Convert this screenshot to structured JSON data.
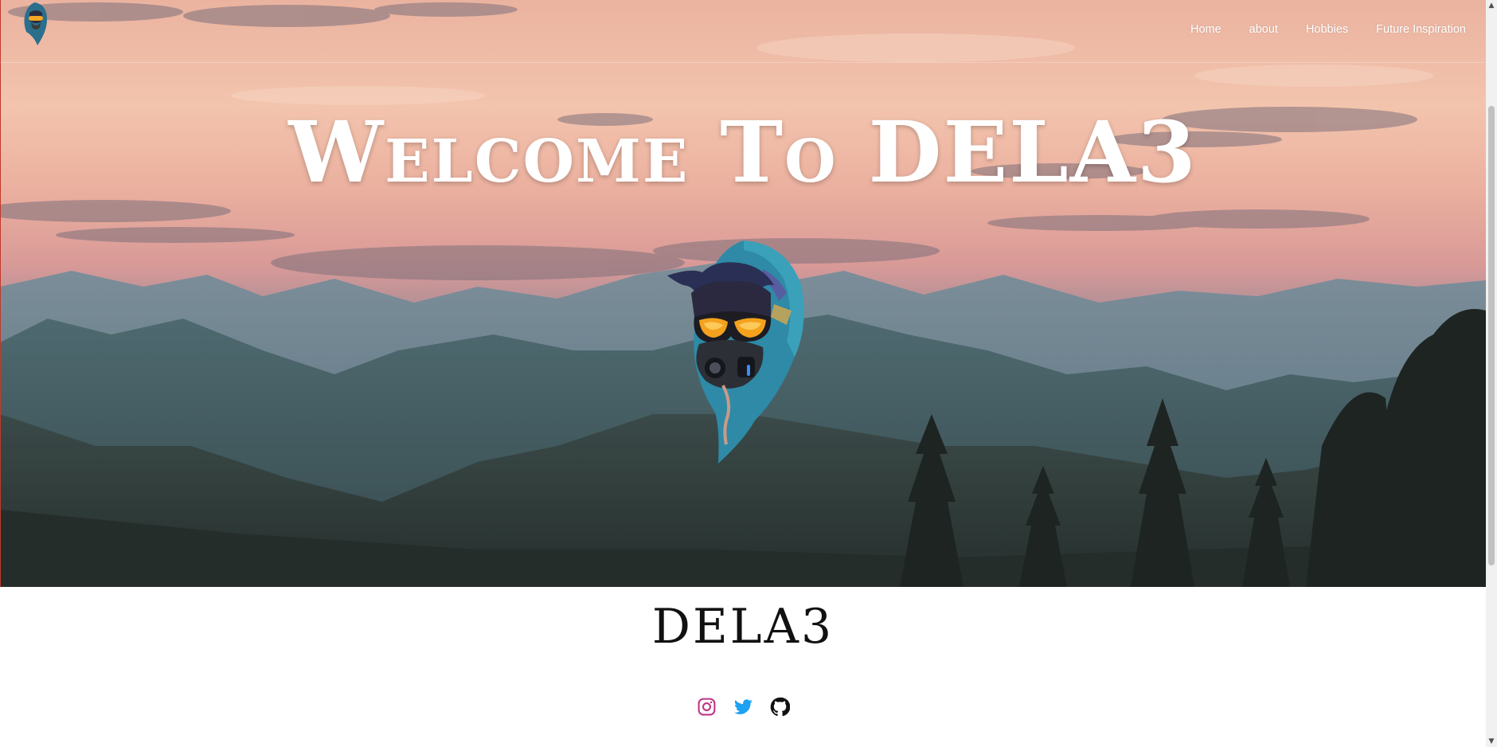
{
  "nav": {
    "logo_icon": "hooded-avatar-icon",
    "links": [
      {
        "label": "Home"
      },
      {
        "label": "about"
      },
      {
        "label": "Hobbies"
      },
      {
        "label": "Future Inspiration"
      }
    ]
  },
  "hero": {
    "title": "Welcome To DELA3",
    "avatar_icon": "hooded-gas-mask-avatar-icon",
    "background": "sunset-mountain-landscape"
  },
  "main": {
    "site_name": "DELA3",
    "socials": [
      {
        "icon": "instagram-icon",
        "color": "#c13584"
      },
      {
        "icon": "twitter-icon",
        "color": "#1da1f2"
      },
      {
        "icon": "github-icon",
        "color": "#111111"
      }
    ]
  },
  "scrollbar": {
    "up_arrow": "▲",
    "down_arrow": "▼"
  }
}
